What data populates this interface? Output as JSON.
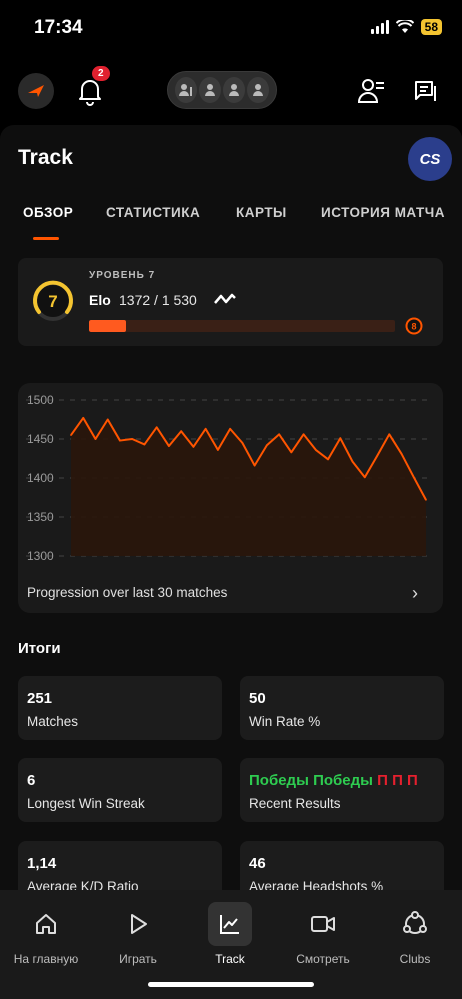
{
  "status": {
    "time": "17:34",
    "battery": "58"
  },
  "header": {
    "notifications_count": "2"
  },
  "page": {
    "title": "Track",
    "game_logo": "CS"
  },
  "tabs": [
    {
      "label": "ОБЗОР",
      "active": true
    },
    {
      "label": "СТАТИСТИКА",
      "active": false
    },
    {
      "label": "КАРТЫ",
      "active": false
    },
    {
      "label": "ИСТОРИЯ МАТЧА",
      "active": false
    }
  ],
  "level": {
    "label": "УРОВЕНЬ 7",
    "number": "7",
    "elo_label": "Elo",
    "elo_value": "1372 / 1 530",
    "next_level": "8",
    "progress_fraction": 0.12
  },
  "chart_data": {
    "type": "area",
    "caption": "Progression over last 30 matches",
    "ylim": [
      1300,
      1500
    ],
    "yticks": [
      "1500",
      "1450",
      "1400",
      "1350",
      "1300"
    ],
    "values": [
      1455,
      1477,
      1450,
      1475,
      1448,
      1450,
      1443,
      1465,
      1441,
      1460,
      1440,
      1463,
      1436,
      1463,
      1445,
      1416,
      1442,
      1456,
      1433,
      1456,
      1436,
      1424,
      1451,
      1421,
      1401,
      1428,
      1456,
      1431,
      1401,
      1372
    ],
    "grid": true,
    "colors": {
      "line": "#ff5500",
      "fill": "#2a160b"
    }
  },
  "summary": {
    "title": "Итоги",
    "stats": [
      {
        "value": "251",
        "label": "Matches"
      },
      {
        "value": "50",
        "label": "Win Rate %"
      },
      {
        "value": "6",
        "label": "Longest Win Streak"
      },
      {
        "value": "",
        "label": "Recent Results"
      },
      {
        "value": "1,14",
        "label": "Average K/D Ratio"
      },
      {
        "value": "46",
        "label": "Average Headshots %"
      }
    ],
    "recent_results": [
      "Победы",
      "Победы",
      "П",
      "П",
      "П"
    ]
  },
  "nav": [
    {
      "label": "На главную",
      "icon": "home-icon"
    },
    {
      "label": "Играть",
      "icon": "play-icon"
    },
    {
      "label": "Track",
      "icon": "chart-icon",
      "active": true
    },
    {
      "label": "Смотреть",
      "icon": "video-icon"
    },
    {
      "label": "Clubs",
      "icon": "clubs-icon"
    }
  ],
  "colors": {
    "accent": "#ff5500",
    "win": "#2ecc50",
    "loss": "#e5202e",
    "level_ring": "#f4c430"
  }
}
